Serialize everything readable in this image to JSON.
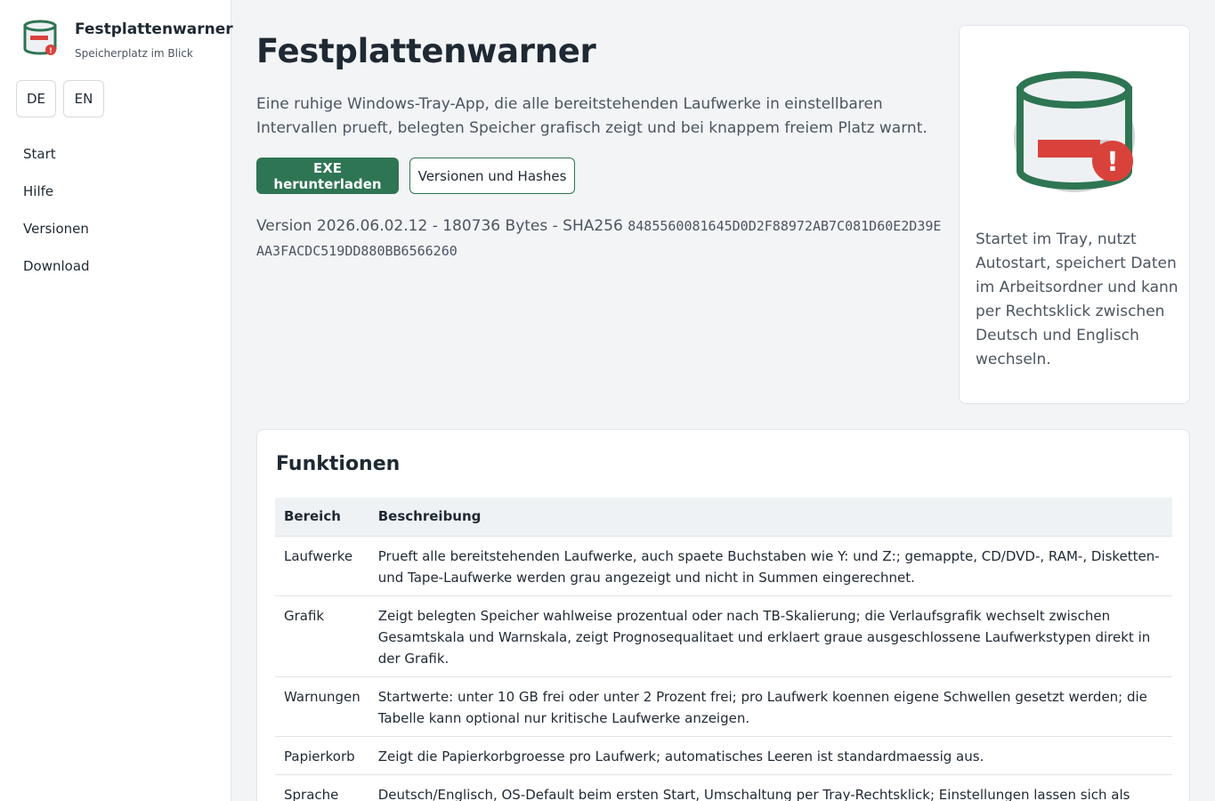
{
  "brand": {
    "title": "Festplattenwarner",
    "subtitle": "Speicherplatz im Blick"
  },
  "languages": [
    "DE",
    "EN"
  ],
  "nav": [
    "Start",
    "Hilfe",
    "Versionen",
    "Download"
  ],
  "hero": {
    "title": "Festplattenwarner",
    "description": "Eine ruhige Windows-Tray-App, die alle bereitstehenden Laufwerke in einstellbaren Intervallen prueft, belegten Speicher grafisch zeigt und bei knappem freiem Platz warnt.",
    "download_label": "EXE herunterladen",
    "versions_label": "Versionen und Hashes",
    "version_prefix": "Version 2026.06.02.12 - 180736 Bytes - SHA256",
    "sha256": "8485560081645D0D2F88972AB7C081D60E2D39EAA3FACDC519DD880BB6566260"
  },
  "side_card": {
    "text": "Startet im Tray, nutzt Autostart, speichert Daten im Arbeitsordner und kann per Rechtsklick zwischen Deutsch und Englisch wechseln.",
    "icon": "drive-warning-icon",
    "colors": {
      "green": "#2e7553",
      "red": "#d9423b",
      "grey": "#d0d3d6"
    }
  },
  "functions": {
    "title": "Funktionen",
    "headers": [
      "Bereich",
      "Beschreibung"
    ],
    "rows": [
      [
        "Laufwerke",
        "Prueft alle bereitstehenden Laufwerke, auch spaete Buchstaben wie Y: und Z:; gemappte, CD/DVD-, RAM-, Disketten- und Tape-Laufwerke werden grau angezeigt und nicht in Summen eingerechnet."
      ],
      [
        "Grafik",
        "Zeigt belegten Speicher wahlweise prozentual oder nach TB-Skalierung; die Verlaufsgrafik wechselt zwischen Gesamtskala und Warnskala, zeigt Prognosequalitaet und erklaert graue ausgeschlossene Laufwerkstypen direkt in der Grafik."
      ],
      [
        "Warnungen",
        "Startwerte: unter 10 GB frei oder unter 2 Prozent frei; pro Laufwerk koennen eigene Schwellen gesetzt werden; die Tabelle kann optional nur kritische Laufwerke anzeigen."
      ],
      [
        "Papierkorb",
        "Zeigt die Papierkorbgroesse pro Laufwerk; automatisches Leeren ist standardmaessig aus."
      ],
      [
        "Sprache",
        "Deutsch/Englisch, OS-Default beim ersten Start, Umschaltung per Tray-Rechtsklick; Einstellungen lassen sich als JSON exportieren und importieren."
      ]
    ]
  }
}
